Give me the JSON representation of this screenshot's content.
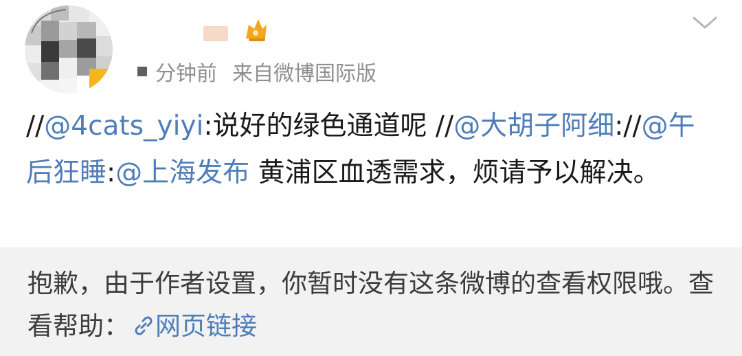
{
  "header": {
    "time_text": "分钟前",
    "source_text": "来自微博国际版"
  },
  "content": {
    "prefix1": "//",
    "mention1": "@4cats_yiyi",
    "text1": ":说好的绿色通道呢 //",
    "mention2": "@大胡子阿细",
    "text2": "://",
    "mention3": "@午后狂睡",
    "text3": ":",
    "mention4": "@上海发布",
    "text4": " 黄浦区血透需求，烦请予以解决。"
  },
  "notice": {
    "text": "抱歉，由于作者设置，你暂时没有这条微博的查看权限哦。查看帮助：",
    "link_text": "网页链接"
  },
  "colors": {
    "mention": "#4f7db9",
    "notice_bg": "#f2f2f2"
  },
  "icons": {
    "vip_badge": "vip-badge-icon",
    "chevron": "chevron-down-icon",
    "link": "link-icon"
  }
}
